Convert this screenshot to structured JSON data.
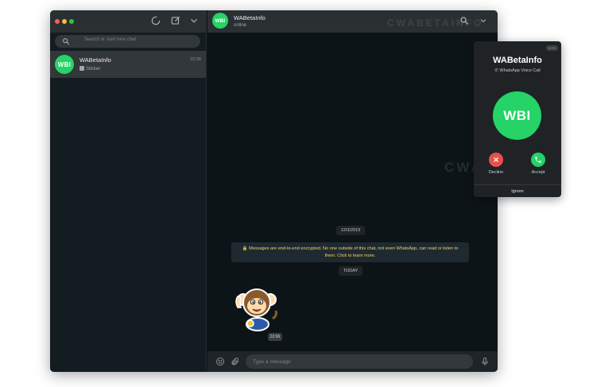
{
  "sidebar": {
    "search_placeholder": "Search or start new chat",
    "chats": [
      {
        "name": "WABetaInfo",
        "time": "22:06",
        "preview": "Sticker",
        "avatar_text": "WBI"
      }
    ]
  },
  "conversation": {
    "contact_name": "WABetaInfo",
    "contact_status": "online",
    "avatar_text": "WBI",
    "watermark": "CWABETAINFO",
    "date_chip": "12/3/2019",
    "encryption_notice": "Messages are end-to-end encrypted. No one outside of this chat, not even WhatsApp, can read or listen to them. Click to learn more.",
    "today_chip": "TODAY",
    "sticker_time": "22:06",
    "composer_placeholder": "Type a message"
  },
  "call": {
    "badge": "WTB",
    "caller_name": "WABetaInfo",
    "call_type": "WhatsApp Voice Call",
    "avatar_text": "WBI",
    "decline_label": "Decline",
    "accept_label": "Accept",
    "ignore_label": "Ignore"
  },
  "colors": {
    "accent_green": "#25d366",
    "decline_red": "#e9504b",
    "encryption_text": "#f6d06c"
  }
}
